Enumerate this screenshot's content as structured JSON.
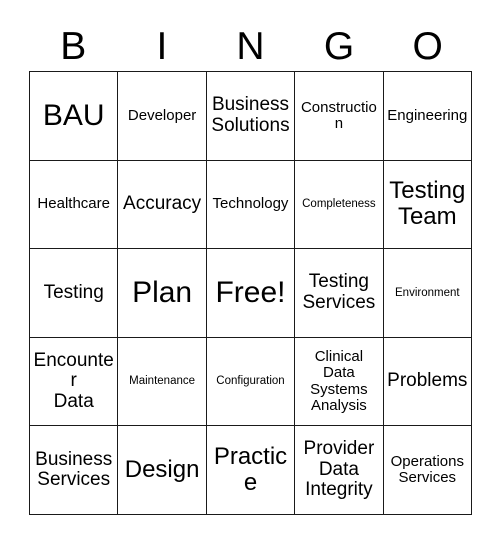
{
  "card": {
    "headers": [
      "B",
      "I",
      "N",
      "G",
      "O"
    ],
    "rows": [
      [
        {
          "text": "BAU",
          "size": "xl"
        },
        {
          "text": "Developer",
          "size": "sm"
        },
        {
          "text": "Business\nSolutions",
          "size": "md"
        },
        {
          "text": "Construction",
          "size": "sm"
        },
        {
          "text": "Engineering",
          "size": "sm"
        }
      ],
      [
        {
          "text": "Healthcare",
          "size": "sm"
        },
        {
          "text": "Accuracy",
          "size": "md"
        },
        {
          "text": "Technology",
          "size": "sm"
        },
        {
          "text": "Completeness",
          "size": "xs"
        },
        {
          "text": "Testing\nTeam",
          "size": "lg"
        }
      ],
      [
        {
          "text": "Testing",
          "size": "md"
        },
        {
          "text": "Plan",
          "size": "xl"
        },
        {
          "text": "Free!",
          "size": "xl"
        },
        {
          "text": "Testing\nServices",
          "size": "md"
        },
        {
          "text": "Environment",
          "size": "xs"
        }
      ],
      [
        {
          "text": "Encounter\nData",
          "size": "md"
        },
        {
          "text": "Maintenance",
          "size": "xs"
        },
        {
          "text": "Configuration",
          "size": "xs"
        },
        {
          "text": "Clinical\nData\nSystems\nAnalysis",
          "size": "sm"
        },
        {
          "text": "Problems",
          "size": "md"
        }
      ],
      [
        {
          "text": "Business\nServices",
          "size": "md"
        },
        {
          "text": "Design",
          "size": "lg"
        },
        {
          "text": "Practice",
          "size": "lg"
        },
        {
          "text": "Provider\nData\nIntegrity",
          "size": "md"
        },
        {
          "text": "Operations\nServices",
          "size": "sm"
        }
      ]
    ]
  },
  "colors": {
    "grid_line": "#1a1a1a",
    "text": "#000000",
    "background": "#ffffff"
  }
}
